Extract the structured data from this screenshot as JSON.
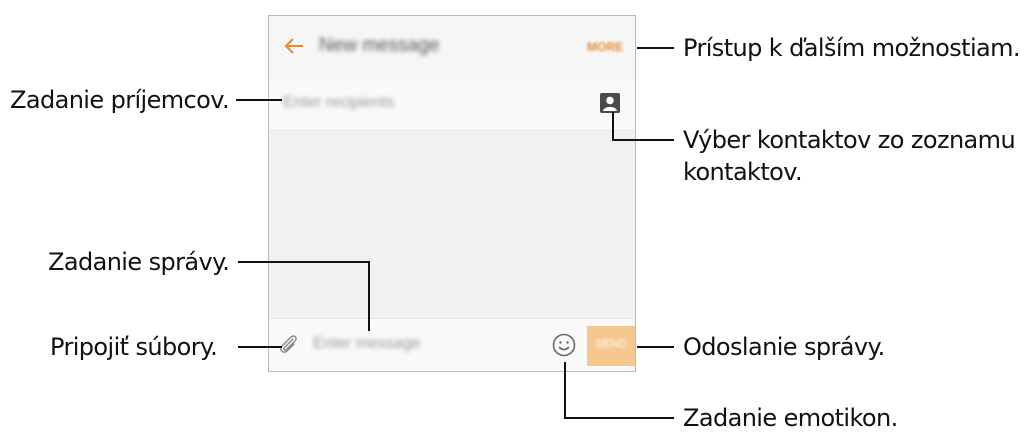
{
  "screen": {
    "title": "New message",
    "more_label": "MORE",
    "recipients_placeholder": "Enter recipients",
    "message_placeholder": "Enter message",
    "send_label": "SEND"
  },
  "callouts": {
    "recipients": "Zadanie príjemcov.",
    "more_options": "Prístup k ďalším možnostiam.",
    "contacts_line1": "Výber kontaktov zo zoznamu",
    "contacts_line2": "kontaktov.",
    "message": "Zadanie správy.",
    "attach": "Pripojiť súbory.",
    "send": "Odoslanie správy.",
    "emoticons": "Zadanie emotikon."
  },
  "icons": [
    "back-arrow-icon",
    "contact-icon",
    "attach-icon",
    "emoji-icon"
  ],
  "colors": {
    "accent": "#e48a33",
    "send_button": "#f6c890",
    "screen_bg": "#f1f1f1"
  }
}
